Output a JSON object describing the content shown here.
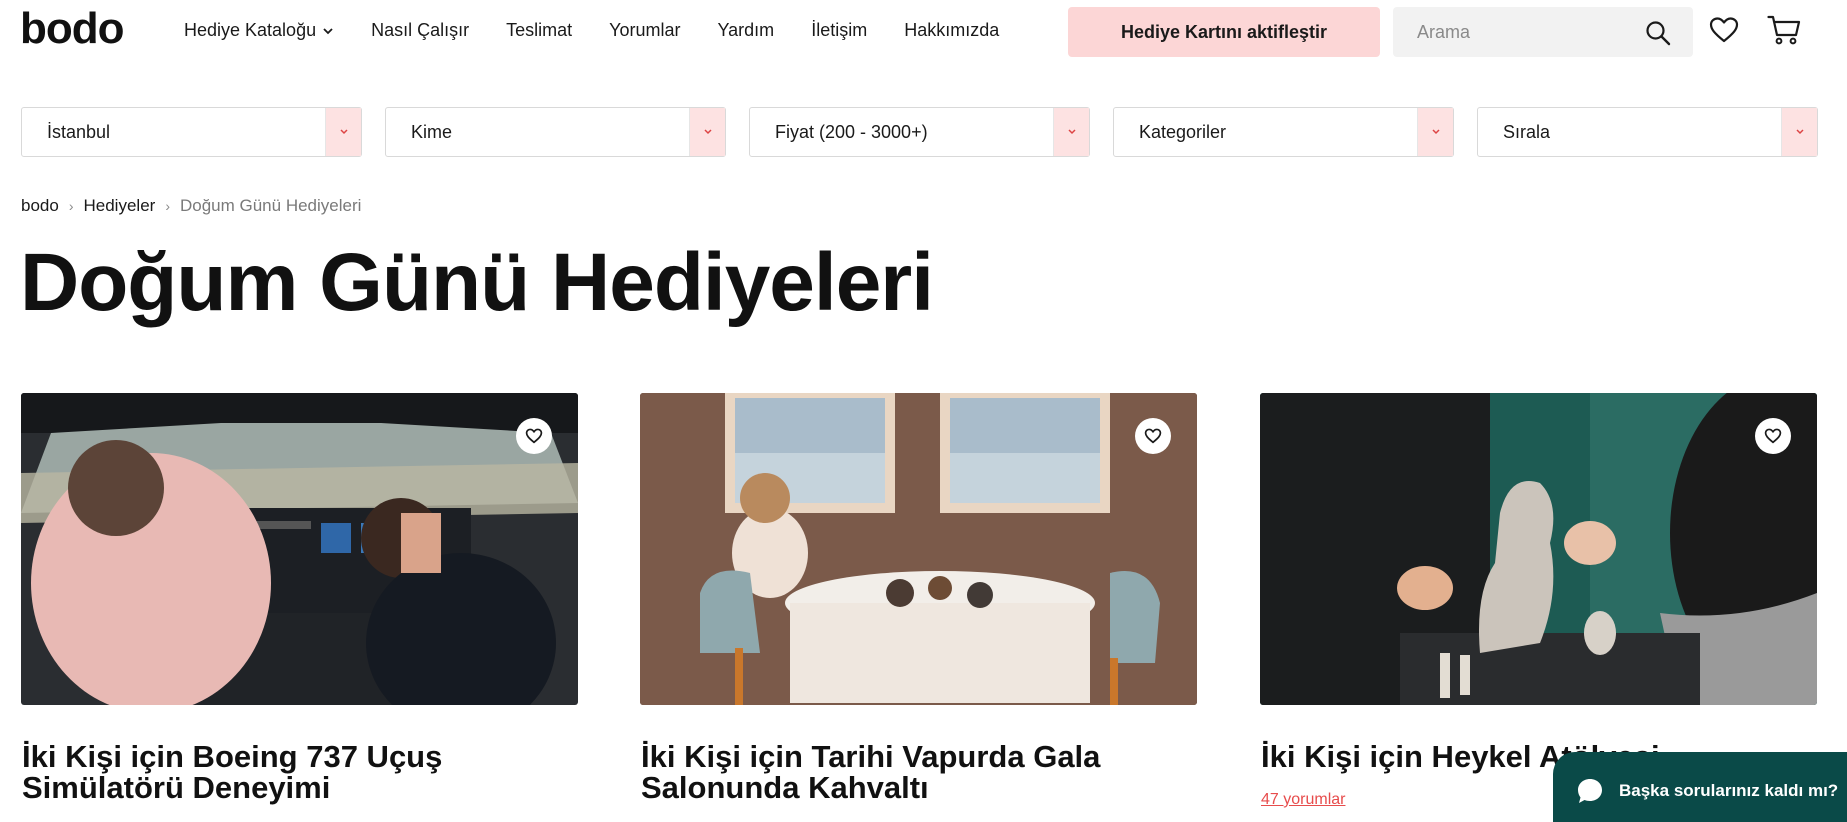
{
  "header": {
    "logo": "bodo",
    "nav": [
      {
        "label": "Hediye Kataloğu",
        "has_dropdown": true
      },
      {
        "label": "Nasıl Çalışır"
      },
      {
        "label": "Teslimat"
      },
      {
        "label": "Yorumlar"
      },
      {
        "label": "Yardım"
      },
      {
        "label": "İletişim"
      },
      {
        "label": "Hakkımızda"
      }
    ],
    "activate_label": "Hediye Kartını aktifleştir",
    "search_placeholder": "Arama",
    "icons": [
      "search-icon",
      "heart-icon",
      "cart-icon"
    ]
  },
  "filters": [
    {
      "label": "İstanbul"
    },
    {
      "label": "Kime"
    },
    {
      "label": "Fiyat (200 - 3000+)"
    },
    {
      "label": "Kategoriler"
    },
    {
      "label": "Sırala"
    }
  ],
  "breadcrumb": {
    "items": [
      "bodo",
      "Hediyeler"
    ],
    "current": "Doğum Günü Hediyeleri"
  },
  "page_title": "Doğum Günü Hediyeleri",
  "cards": [
    {
      "title": "İki Kişi için Boeing 737 Uçuş Simülatörü Deneyimi",
      "reviews": ""
    },
    {
      "title": "İki Kişi için Tarihi Vapurda Gala Salonunda Kahvaltı",
      "reviews": ""
    },
    {
      "title": "İki Kişi için Heykel Atölyesi",
      "reviews": "47 yorumlar"
    }
  ],
  "chat": {
    "label": "Başka sorularınız kaldı mı?"
  },
  "colors": {
    "accent_pink": "#fcd6d6",
    "review_red": "#e74c4c",
    "chat_teal": "#0a4a48"
  }
}
